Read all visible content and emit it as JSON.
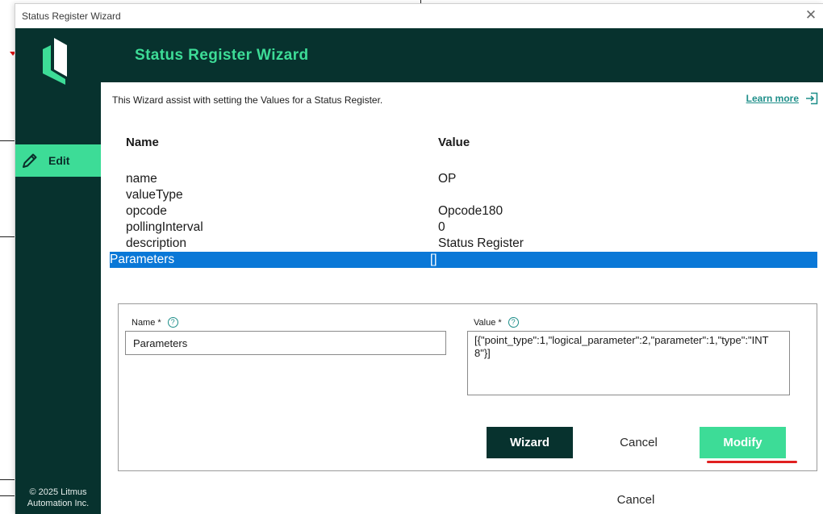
{
  "window": {
    "title": "Status Register Wizard",
    "close_icon": "close-icon"
  },
  "header": {
    "title": "Status Register Wizard"
  },
  "sidebar": {
    "logo_icon": "litmus-logo-icon",
    "items": [
      {
        "label": "Edit",
        "icon": "pencil-icon",
        "active": true
      }
    ],
    "copyright_line1": "© 2025 Litmus",
    "copyright_line2": "Automation Inc."
  },
  "intro": {
    "text": "This Wizard assist with setting the Values for a Status Register.",
    "learn_more": "Learn more",
    "learn_more_icon": "open-external-icon"
  },
  "grid": {
    "headers": {
      "name": "Name",
      "value": "Value"
    },
    "rows": [
      {
        "name": "name",
        "value": "OP"
      },
      {
        "name": "valueType",
        "value": ""
      },
      {
        "name": "opcode",
        "value": "Opcode180"
      },
      {
        "name": "pollingInterval",
        "value": "0"
      },
      {
        "name": "description",
        "value": "Status Register"
      },
      {
        "name": "Parameters",
        "value": "[]",
        "selected": true
      }
    ]
  },
  "form": {
    "name_label": "Name *",
    "value_label": "Value *",
    "help_icon": "help-icon",
    "name_value": "Parameters",
    "value_value": "[{\"point_type\":1,\"logical_parameter\":2,\"parameter\":1,\"type\":\"INT8\"}]",
    "wizard_button": "Wizard",
    "cancel_button": "Cancel",
    "modify_button": "Modify"
  },
  "footer": {
    "cancel_button": "Cancel"
  },
  "colors": {
    "dark_teal": "#07322e",
    "accent_green": "#3ddc97",
    "selection_blue": "#0a78d7",
    "link_teal": "#1f8f8a",
    "annotation_red": "#e02020"
  }
}
